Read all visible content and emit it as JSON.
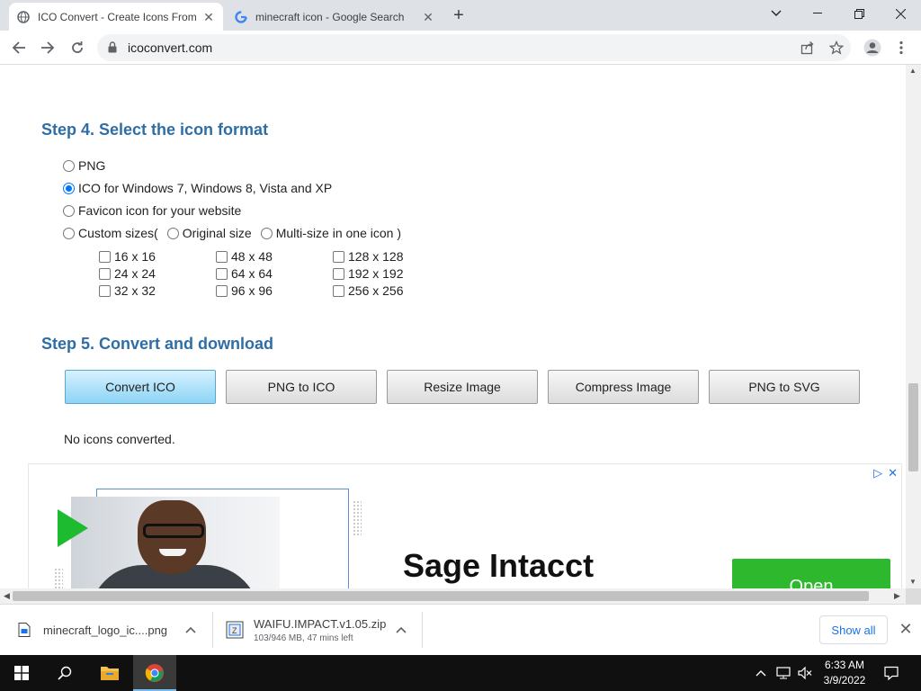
{
  "browser": {
    "tabs": [
      {
        "title": "ICO Convert - Create Icons From",
        "active": true
      },
      {
        "title": "minecraft icon - Google Search",
        "active": false
      }
    ],
    "url": "icoconvert.com"
  },
  "step4": {
    "heading": "Step 4. Select the icon format",
    "options": [
      {
        "label": "PNG",
        "checked": false
      },
      {
        "label": "ICO for Windows 7, Windows 8, Vista and XP",
        "checked": true
      },
      {
        "label": "Favicon icon for your website",
        "checked": false
      }
    ],
    "custom": {
      "label": "Custom sizes(",
      "original_label": "Original size",
      "multi_label": "Multi-size in one icon )"
    },
    "sizes": [
      "16 x 16",
      "48 x 48",
      "128 x 128",
      "24 x 24",
      "64 x 64",
      "192 x 192",
      "32 x 32",
      "96 x 96",
      "256 x 256"
    ]
  },
  "step5": {
    "heading": "Step 5. Convert and download",
    "buttons": [
      "Convert ICO",
      "PNG to ICO",
      "Resize Image",
      "Compress Image",
      "PNG to SVG"
    ],
    "status": "No icons converted."
  },
  "ad": {
    "brand": "Sage Intacct",
    "cta": "Open"
  },
  "downloads": {
    "items": [
      {
        "name": "minecraft_logo_ic....png",
        "sub": ""
      },
      {
        "name": "WAIFU.IMPACT.v1.05.zip",
        "sub": "103/946 MB, 47 mins left"
      }
    ],
    "show_all": "Show all"
  },
  "taskbar": {
    "time": "6:33 AM",
    "date": "3/9/2022"
  },
  "colors": {
    "heading": "#2f6ea5",
    "accent_button": "#8dd4f5",
    "ad_green": "#2eb82e"
  }
}
